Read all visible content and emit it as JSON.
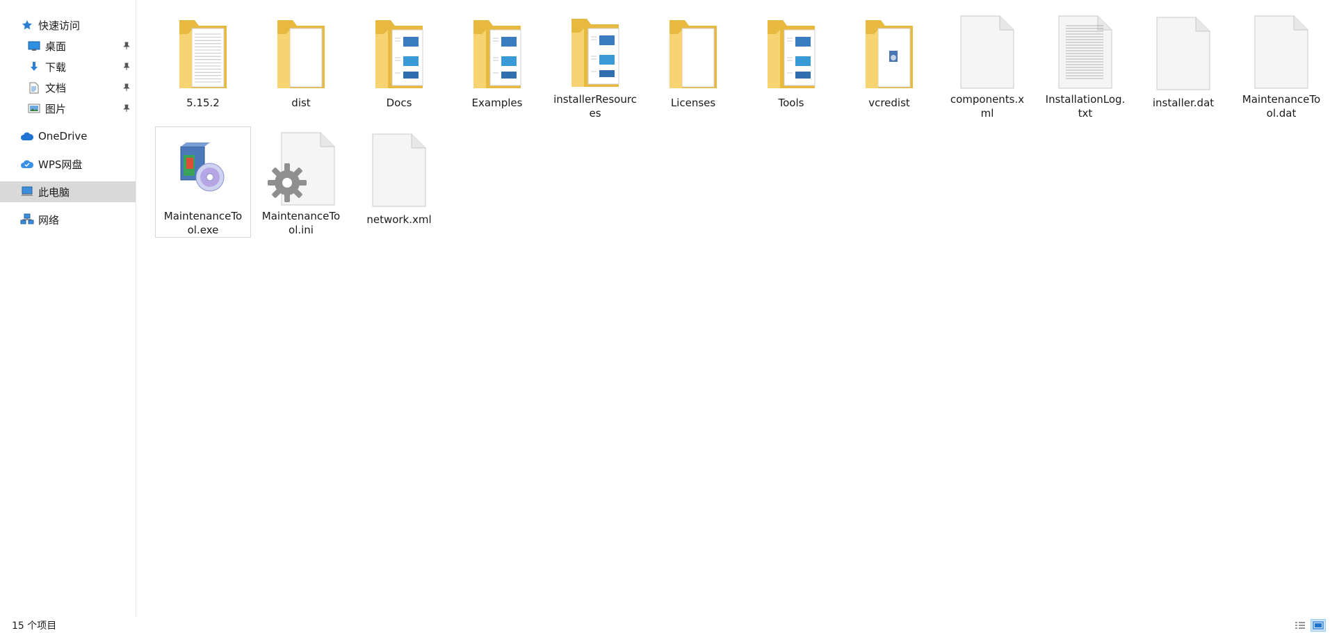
{
  "sidebar": {
    "quick_access": {
      "label": "快速访问",
      "icon": "star-icon"
    },
    "pinned": [
      {
        "label": "桌面",
        "icon": "desktop-icon"
      },
      {
        "label": "下载",
        "icon": "download-icon"
      },
      {
        "label": "文档",
        "icon": "document-icon"
      },
      {
        "label": "图片",
        "icon": "pictures-icon"
      }
    ],
    "onedrive": {
      "label": "OneDrive",
      "icon": "cloud-icon"
    },
    "wps": {
      "label": "WPS网盘",
      "icon": "wps-cloud-icon"
    },
    "this_pc": {
      "label": "此电脑",
      "icon": "computer-icon",
      "selected": true
    },
    "network": {
      "label": "网络",
      "icon": "network-icon"
    }
  },
  "files": [
    {
      "name": "5.15.2",
      "type": "folder",
      "variant": "docs"
    },
    {
      "name": "dist",
      "type": "folder",
      "variant": "plain"
    },
    {
      "name": "Docs",
      "type": "folder",
      "variant": "images"
    },
    {
      "name": "Examples",
      "type": "folder",
      "variant": "images"
    },
    {
      "name": "installerResources",
      "type": "folder",
      "variant": "images"
    },
    {
      "name": "Licenses",
      "type": "folder",
      "variant": "plain"
    },
    {
      "name": "Tools",
      "type": "folder",
      "variant": "images"
    },
    {
      "name": "vcredist",
      "type": "folder",
      "variant": "installer"
    },
    {
      "name": "components.xml",
      "type": "blank"
    },
    {
      "name": "InstallationLog.txt",
      "type": "text"
    },
    {
      "name": "installer.dat",
      "type": "blank"
    },
    {
      "name": "MaintenanceTool.dat",
      "type": "blank"
    },
    {
      "name": "MaintenanceTool.exe",
      "type": "exe",
      "hover": true
    },
    {
      "name": "MaintenanceTool.ini",
      "type": "ini"
    },
    {
      "name": "network.xml",
      "type": "blank"
    }
  ],
  "status": {
    "item_count": "15 个项目"
  },
  "colors": {
    "folder_back": "#e8b93f",
    "folder_front": "#f7d371",
    "selected_nav": "#d9d9d9",
    "accent_blue": "#1e73d2"
  }
}
